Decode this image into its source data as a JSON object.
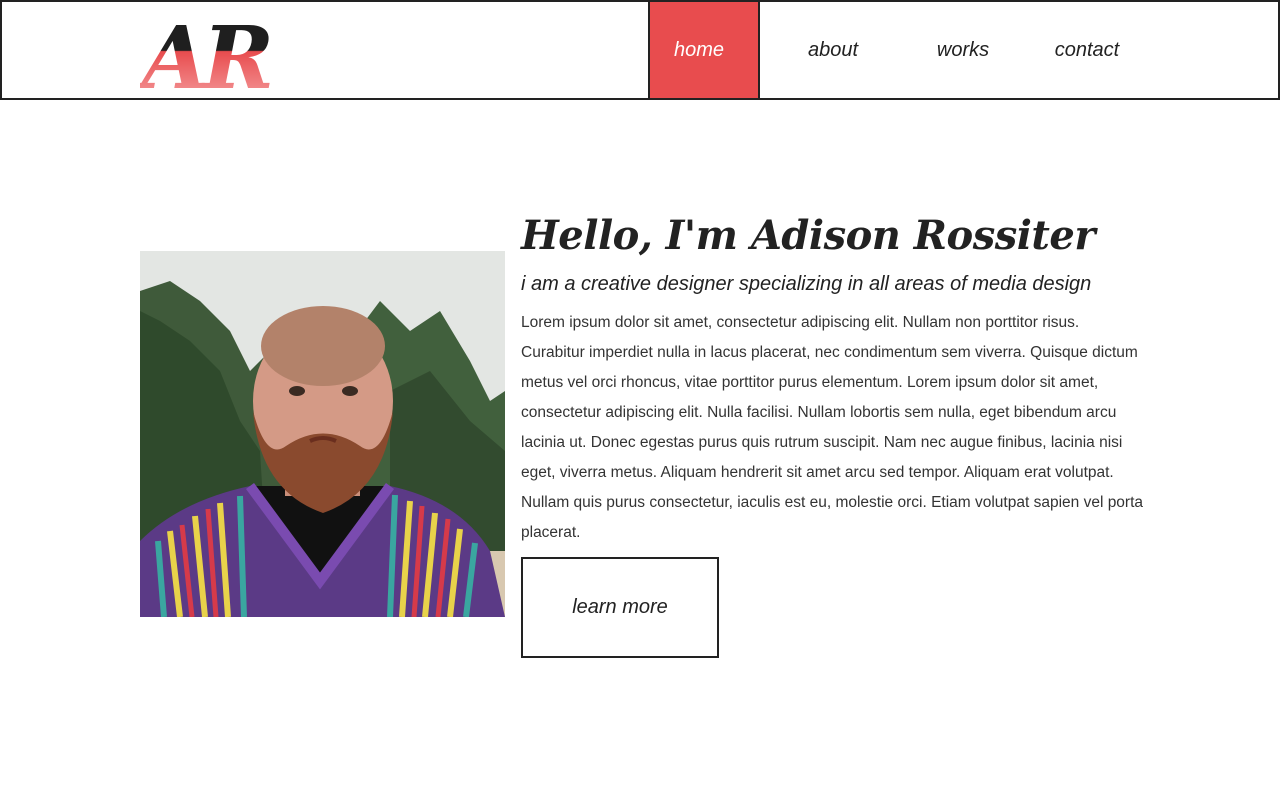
{
  "logo": {
    "text": "AR",
    "colors": {
      "dark": "#1f1f1f",
      "accent": "#e84c4e",
      "accent_light": "#f6a7a8"
    }
  },
  "nav": {
    "items": [
      {
        "label": "home",
        "active": true
      },
      {
        "label": "about",
        "active": false
      },
      {
        "label": "works",
        "active": false
      },
      {
        "label": "contact",
        "active": false
      }
    ]
  },
  "hero": {
    "photo": {
      "icon": "portrait-photo",
      "description_colors": {
        "sky": "#e3e6e3",
        "trees": "#3f5a3a",
        "skin": "#c98f7a",
        "beard": "#8a4a2e"
      }
    },
    "heading": "Hello, I'm Adison Rossiter",
    "subheading": "i am a creative designer specializing in all areas of media design",
    "body": "Lorem ipsum dolor sit amet, consectetur adipiscing elit. Nullam non porttitor risus. Curabitur imperdiet nulla in lacus placerat, nec condimentum sem viverra. Quisque dictum metus vel orci rhoncus, vitae porttitor purus elementum. Lorem ipsum dolor sit amet, consectetur adipiscing elit. Nulla facilisi. Nullam lobortis sem nulla, eget bibendum arcu lacinia ut. Donec egestas purus quis rutrum suscipit. Nam nec augue finibus, lacinia nisi eget, viverra metus. Aliquam hendrerit sit amet arcu sed tempor. Aliquam erat volutpat. Nullam quis purus consectetur, iaculis est eu, molestie orci. Etiam volutpat sapien vel porta placerat.",
    "cta_label": "learn more"
  },
  "theme": {
    "accent": "#e84c4e",
    "text": "#222222",
    "border": "#222222",
    "background": "#ffffff"
  }
}
